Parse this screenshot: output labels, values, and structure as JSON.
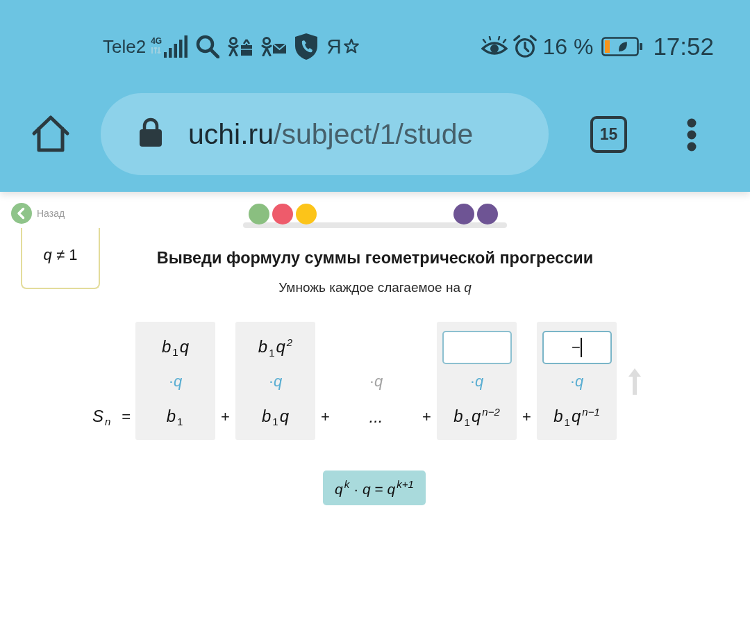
{
  "status_bar": {
    "carrier": "Tele2",
    "network": "4G",
    "app_letter": "Я",
    "battery": "16 %",
    "time": "17:52"
  },
  "browser": {
    "url": {
      "domain": "uchi.ru",
      "path": "/subject/1/stude"
    },
    "tab_count": "15"
  },
  "back": {
    "label": "Назад"
  },
  "progress": {
    "left_dots": [
      {
        "color": "#8abf80"
      },
      {
        "color": "#ee5b6b"
      },
      {
        "color": "#fcc419"
      }
    ],
    "right_dots": [
      {
        "color": "#6e5494"
      },
      {
        "color": "#6e5494"
      }
    ]
  },
  "condition_card": "*q* ≠ 1",
  "title": "Выведи формулу суммы геометрической прогрессии",
  "instruction": "Умножь каждое слагаемое на *q*",
  "equation": {
    "lhs": "S$_{n}$",
    "equals": "=",
    "columns": [
      {
        "kind": "given",
        "top": "b$_{1}$q",
        "multiplier": "·*q*",
        "bottom": "b$_{1}$"
      },
      {
        "kind": "given",
        "sign": "+",
        "top": "b$_{1}$q$^{2}$",
        "multiplier": "·*q*",
        "bottom": "b$_{1}$q"
      },
      {
        "kind": "ellipsis",
        "sign": "+",
        "multiplier": "·*q*",
        "bottom": "..."
      },
      {
        "kind": "blank",
        "sign": "+",
        "answer": {
          "focused": false
        },
        "multiplier": "·*q*",
        "bottom": "b$_{1}$q$^{n−2}$"
      },
      {
        "kind": "blank",
        "sign": "+",
        "answer": {
          "value": "−",
          "focused": true
        },
        "multiplier": "·*q*",
        "bottom": "b$_{1}$q$^{n−1}$"
      }
    ]
  },
  "hint": "*q*$^{k}$ · *q* = *q*$^{k+1}$"
}
